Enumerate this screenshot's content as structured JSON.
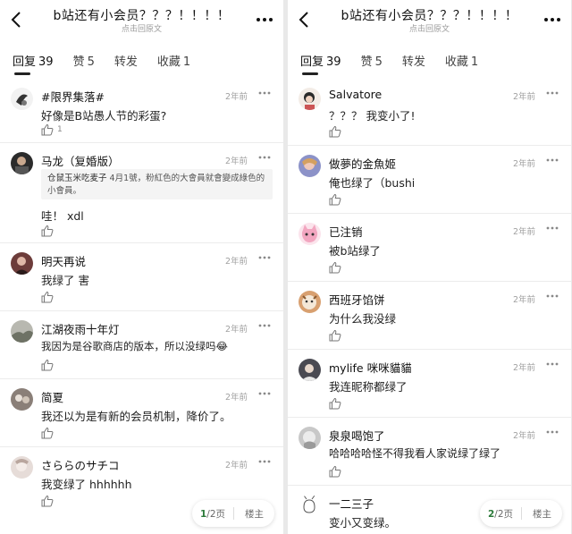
{
  "header": {
    "title": "b站还有小会员？？？！！！！",
    "subtitle": "点击回原文"
  },
  "tabs": [
    {
      "label": "回复",
      "count": "39"
    },
    {
      "label": "赞",
      "count": "5"
    },
    {
      "label": "转发",
      "count": ""
    },
    {
      "label": "收藏",
      "count": "1"
    }
  ],
  "left_comments": [
    {
      "name": "#限界集落#",
      "time": "2年前",
      "text": "好像是B站愚人节的彩蛋?",
      "likes": "1"
    },
    {
      "name": "马龙（复婚版）",
      "time": "2年前",
      "quote_name": "仓鼠玉米吃麦子",
      "quote_text": " 4月1號，粉紅色的大會員就會變成綠色的小會員。",
      "text": "哇！ xdl",
      "likes": ""
    },
    {
      "name": "明天再说",
      "time": "2年前",
      "text": "我绿了 害",
      "likes": ""
    },
    {
      "name": "江湖夜雨十年灯",
      "time": "2年前",
      "text": "我因为是谷歌商店的版本，所以没绿吗😂",
      "likes": ""
    },
    {
      "name": "简夏",
      "time": "2年前",
      "text": "我还以为是有新的会员机制，降价了。",
      "likes": ""
    },
    {
      "name": "さららのサチコ",
      "time": "2年前",
      "text": "我变绿了 hhhhhh",
      "likes": ""
    }
  ],
  "right_comments": [
    {
      "name": "Salvatore",
      "time": "2年前",
      "text": "？？？ 我变小了!",
      "likes": ""
    },
    {
      "name": "做夢的金魚姬",
      "time": "2年前",
      "text": "俺也绿了（bushi",
      "likes": ""
    },
    {
      "name": "已注销",
      "time": "2年前",
      "text": "被b站绿了",
      "likes": ""
    },
    {
      "name": "西班牙馅饼",
      "time": "2年前",
      "text": "为什么我没绿",
      "likes": ""
    },
    {
      "name": "mylife 咪咪貓貓",
      "time": "2年前",
      "text": "我连昵称都绿了",
      "likes": ""
    },
    {
      "name": "泉泉喝饱了",
      "time": "2年前",
      "text": "哈哈哈哈怪不得我看人家说绿了绿了",
      "likes": ""
    },
    {
      "name": "一二三子",
      "time": "",
      "text": "变小又变绿。",
      "likes": ""
    }
  ],
  "pager_left": {
    "current": "1",
    "total": "/2页",
    "owner": "楼主"
  },
  "pager_right": {
    "current": "2",
    "total": "/2页",
    "owner": "楼主"
  },
  "colors": {
    "accent_green": "#2c7a3a",
    "divider": "#ececec",
    "time_gray": "#a0a0a0"
  }
}
